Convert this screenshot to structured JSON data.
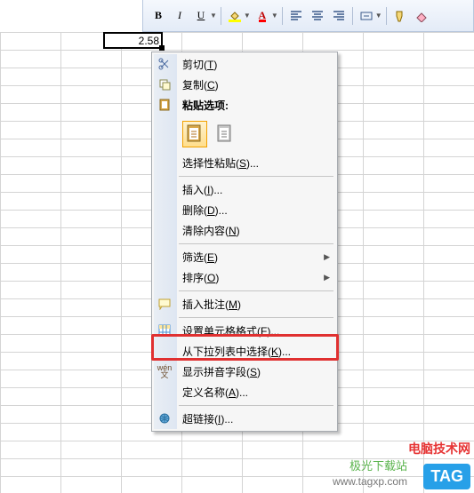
{
  "active_cell": {
    "value": "2.58"
  },
  "toolbar": {
    "bold": "B",
    "italic": "I",
    "underline": "U",
    "font_color_letter": "A"
  },
  "context_menu": {
    "cut": {
      "label": "剪切(",
      "key": "T",
      "tail": ")"
    },
    "copy": {
      "label": "复制(",
      "key": "C",
      "tail": ")"
    },
    "paste_opts": {
      "label": "粘贴选项:"
    },
    "paste_special": {
      "label": "选择性粘贴(",
      "key": "S",
      "tail": ")..."
    },
    "insert": {
      "label": "插入(",
      "key": "I",
      "tail": ")..."
    },
    "delete": {
      "label": "删除(",
      "key": "D",
      "tail": ")..."
    },
    "clear": {
      "label": "清除内容(",
      "key": "N",
      "tail": ")"
    },
    "filter": {
      "label": "筛选(",
      "key": "E",
      "tail": ")"
    },
    "sort": {
      "label": "排序(",
      "key": "O",
      "tail": ")"
    },
    "insert_comment": {
      "label": "插入批注(",
      "key": "M",
      "tail": ")"
    },
    "format_cells": {
      "label": "设置单元格格式(",
      "key": "F",
      "tail": ")..."
    },
    "pick_from_list": {
      "label": "从下拉列表中选择(",
      "key": "K",
      "tail": ")..."
    },
    "show_pinyin": {
      "label": "显示拼音字段(",
      "key": "S",
      "tail": ")"
    },
    "define_name": {
      "label": "定义名称(",
      "key": "A",
      "tail": ")..."
    },
    "hyperlink": {
      "label": "超链接(",
      "key": "I",
      "tail": ")..."
    }
  },
  "watermark": {
    "site1": "电脑技术网",
    "site2": "极光下载站",
    "url": "www.tagxp.com",
    "logo": "TAG"
  },
  "colors": {
    "highlight": "#e03030",
    "menu_border": "#a7abb0",
    "grid_line": "#d4d4d4"
  }
}
